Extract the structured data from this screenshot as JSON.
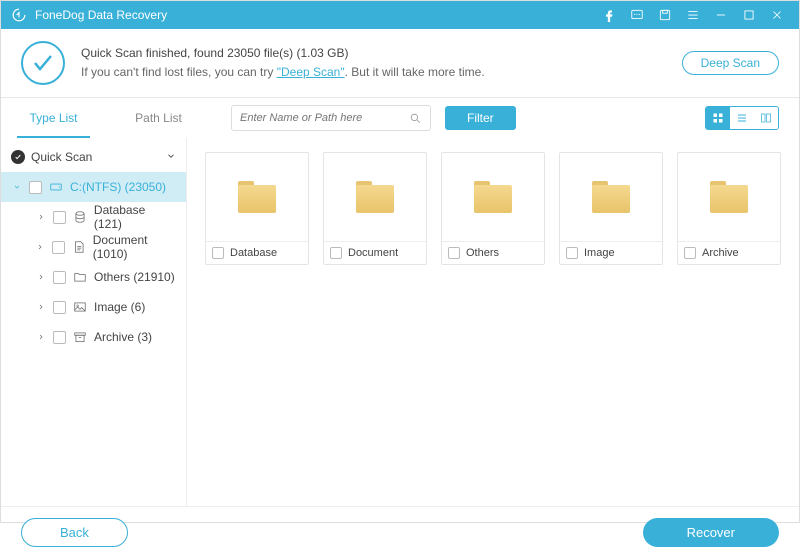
{
  "app": {
    "title": "FoneDog Data Recovery"
  },
  "status": {
    "line1": "Quick Scan finished, found 23050 file(s) (1.03 GB)",
    "line2_prefix": "If you can't find lost files, you can try ",
    "deep_scan_link": "\"Deep Scan\"",
    "line2_suffix": ". But it will take more time.",
    "deep_scan_btn": "Deep Scan"
  },
  "toolbar": {
    "tab_type": "Type List",
    "tab_path": "Path List",
    "search_placeholder": "Enter Name or Path here",
    "filter": "Filter"
  },
  "tree": {
    "root": "Quick Scan",
    "drive": "C:(NTFS) (23050)",
    "items": [
      {
        "label": "Database (121)",
        "icon": "database"
      },
      {
        "label": "Document (1010)",
        "icon": "document"
      },
      {
        "label": "Others (21910)",
        "icon": "folder"
      },
      {
        "label": "Image (6)",
        "icon": "image"
      },
      {
        "label": "Archive (3)",
        "icon": "archive"
      }
    ]
  },
  "grid": {
    "items": [
      {
        "label": "Database"
      },
      {
        "label": "Document"
      },
      {
        "label": "Others"
      },
      {
        "label": "Image"
      },
      {
        "label": "Archive"
      }
    ]
  },
  "footer": {
    "back": "Back",
    "recover": "Recover"
  }
}
